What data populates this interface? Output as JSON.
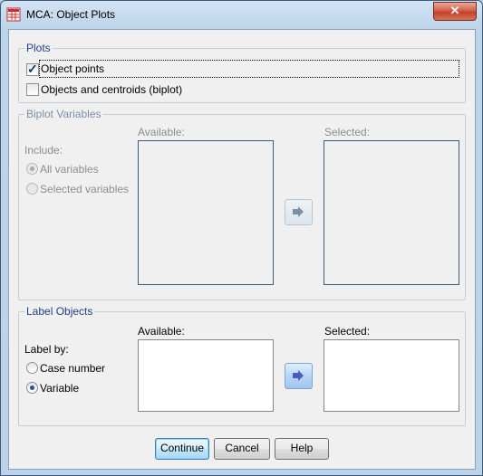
{
  "window": {
    "title": "MCA: Object Plots",
    "close_label": "✕"
  },
  "plots_group": {
    "legend": "Plots",
    "object_points": {
      "label": "Object points",
      "checked": true
    },
    "objects_and_centroids": {
      "label": "Objects and centroids (biplot)",
      "checked": false
    }
  },
  "biplot_group": {
    "legend": "Biplot Variables",
    "include_label": "Include:",
    "all_variables": "All variables",
    "selected_variables": "Selected variables",
    "available_label": "Available:",
    "selected_label": "Selected:"
  },
  "label_group": {
    "legend": "Label Objects",
    "label_by": "Label by:",
    "case_number": "Case number",
    "variable": "Variable",
    "available_label": "Available:",
    "selected_label": "Selected:"
  },
  "buttons": {
    "continue": "Continue",
    "cancel": "Cancel",
    "help": "Help"
  },
  "colors": {
    "accent": "#1d3f8a",
    "title_bg": "#bcd3ea",
    "close_red": "#c24225"
  },
  "icons": {
    "app": "spss-app-icon",
    "move": "move-right-arrow-icon"
  }
}
